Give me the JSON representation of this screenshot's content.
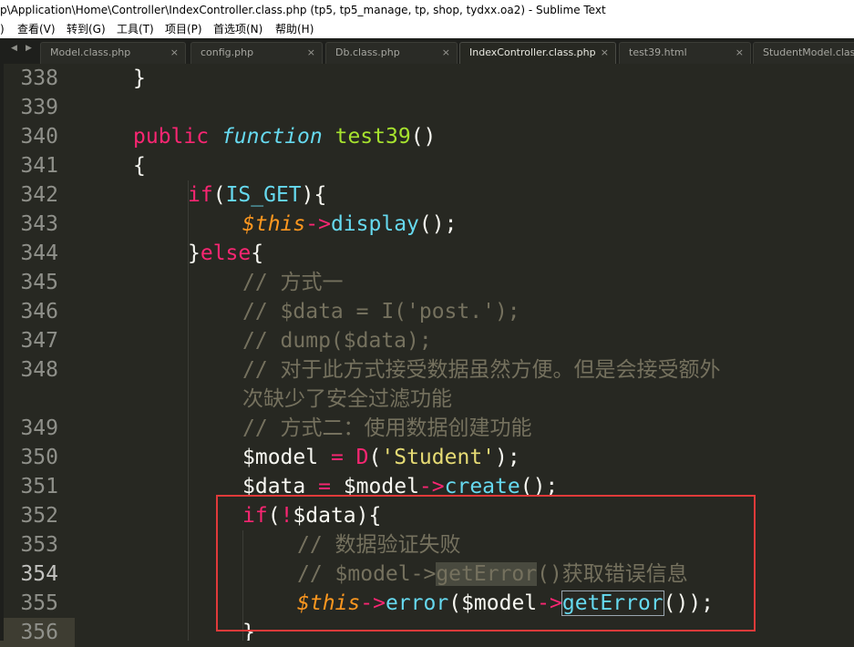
{
  "window": {
    "title": "p\\Application\\Home\\Controller\\IndexController.class.php (tp5, tp5_manage, tp, shop, tydxx.oa2) - Sublime Text"
  },
  "menu": [
    ")",
    "查看(V)",
    "转到(G)",
    "工具(T)",
    "项目(P)",
    "首选项(N)",
    "帮助(H)"
  ],
  "tabs": [
    {
      "label": "Model.class.php",
      "active": false
    },
    {
      "label": "config.php",
      "active": false
    },
    {
      "label": "Db.class.php",
      "active": false
    },
    {
      "label": "IndexController.class.php",
      "active": true
    },
    {
      "label": "test39.html",
      "active": false
    },
    {
      "label": "StudentModel.class",
      "active": false
    }
  ],
  "tab_close_glyph": "×",
  "nav_arrows": {
    "left": "◀",
    "right": "▶"
  },
  "line_numbers": [
    "338",
    "339",
    "340",
    "341",
    "342",
    "343",
    "344",
    "345",
    "346",
    "347",
    "348",
    "349",
    "350",
    "351",
    "352",
    "353",
    "354",
    "355",
    "356"
  ],
  "current_line": "354",
  "code": {
    "l338": "}",
    "l340_kw": "public",
    "l340_fn_kw": "function",
    "l340_name": "test39",
    "l340_parens": "()",
    "l341": "{",
    "l342_if": "if",
    "l342_open": "(",
    "l342_const": "IS_GET",
    "l342_close": "){",
    "l343_this": "$this",
    "l343_arrow": "->",
    "l343_method": "display",
    "l343_end": "();",
    "l344_close": "}",
    "l344_else": "else",
    "l344_open": "{",
    "l345": "// 方式一",
    "l346": "// $data = I('post.');",
    "l347": "// dump($data);",
    "l348a": "// 对于此方式接受数据虽然方便。但是会接受额外",
    "l348b": "次缺少了安全过滤功能",
    "l349": "// 方式二：使用数据创建功能",
    "l350_var": "$model",
    "l350_eq": "=",
    "l350_fn": "D",
    "l350_open": "(",
    "l350_str": "'Student'",
    "l350_close": ");",
    "l351_var": "$data",
    "l351_eq": "=",
    "l351_obj": "$model",
    "l351_arrow": "->",
    "l351_method": "create",
    "l351_end": "();",
    "l352_if": "if",
    "l352_open": "(",
    "l352_not": "!",
    "l352_var": "$data",
    "l352_close": "){",
    "l353": "// 数据验证失败",
    "l354_pre": "// $model->",
    "l354_hl": "getError",
    "l354_post": "()获取错误信息",
    "l355_this": "$this",
    "l355_arrow": "->",
    "l355_method": "error",
    "l355_open": "(",
    "l355_obj": "$model",
    "l355_arrow2": "->",
    "l355_call": "getError",
    "l355_end": "());",
    "l356": "}"
  },
  "colors": {
    "background": "#272822",
    "keyword": "#f92672",
    "storage": "#66d9ef",
    "function_name": "#a6e22e",
    "variable": "#fd971f",
    "comment": "#75715e",
    "string": "#e6db74",
    "annotation_box": "#e03a3a"
  }
}
